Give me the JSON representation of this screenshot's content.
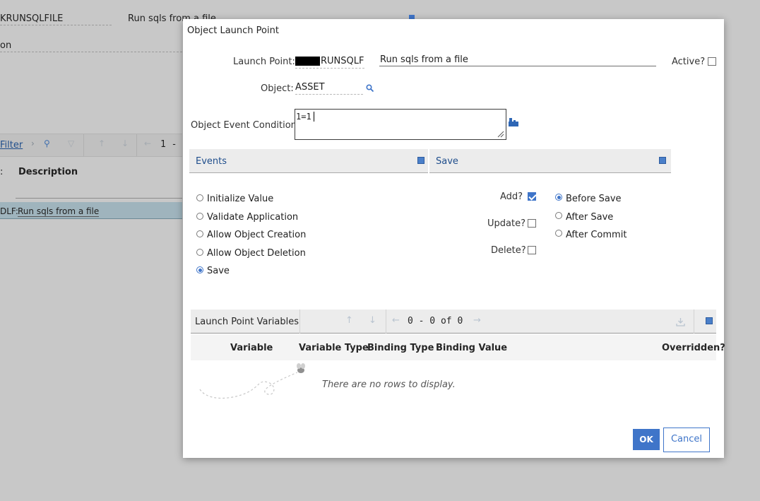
{
  "background": {
    "field_value": "KRUNSQLFILE",
    "field_desc": "Run sqls from a file",
    "label_fragment": "on",
    "filter_label": "Filter",
    "page_fragment": "1 -",
    "col_fragment": ":",
    "description_header": "Description",
    "row_key_fragment": "DLF:",
    "row_desc": "Run sqls from a file"
  },
  "dialog": {
    "title": "Object Launch Point",
    "launch_point_label": "Launch Point:",
    "launch_point_value": "RUNSQLF",
    "launch_point_desc": "Run sqls from a file",
    "active_label": "Active?",
    "active_checked": false,
    "object_label": "Object:",
    "object_value": "ASSET",
    "condition_label": "Object Event Condition:",
    "condition_value": "1=1",
    "events_header": "Events",
    "save_header": "Save",
    "events": [
      {
        "label": "Initialize Value",
        "selected": false
      },
      {
        "label": "Validate Application",
        "selected": false
      },
      {
        "label": "Allow Object Creation",
        "selected": false
      },
      {
        "label": "Allow Object Deletion",
        "selected": false
      },
      {
        "label": "Save",
        "selected": true
      }
    ],
    "save_checks": [
      {
        "label": "Add?",
        "checked": true
      },
      {
        "label": "Update?",
        "checked": false
      },
      {
        "label": "Delete?",
        "checked": false
      }
    ],
    "save_timing": [
      {
        "label": "Before Save",
        "selected": true
      },
      {
        "label": "After Save",
        "selected": false
      },
      {
        "label": "After Commit",
        "selected": false
      }
    ],
    "variables": {
      "title": "Launch Point Variables",
      "pager": "0 - 0 of 0",
      "columns": [
        "Variable",
        "Variable Type",
        "Binding Type",
        "Binding Value",
        "Overridden?"
      ],
      "empty_message": "There are no rows to display."
    },
    "ok_label": "OK",
    "cancel_label": "Cancel"
  },
  "colors": {
    "accent": "#3f75c9",
    "link": "#1f4e8c",
    "overlay": "#c8c8c8"
  }
}
